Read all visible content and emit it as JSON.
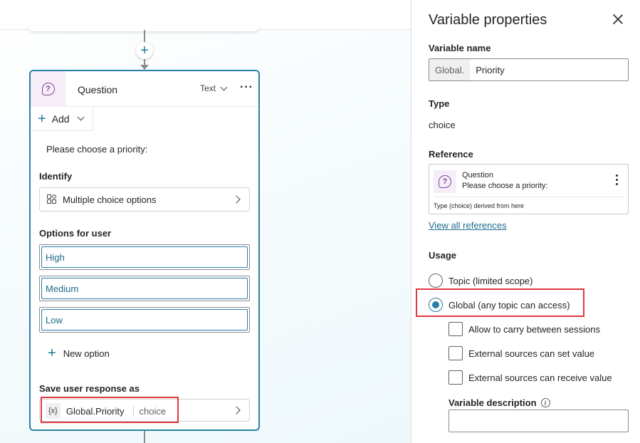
{
  "canvas": {
    "add_node_symbol": "+",
    "node": {
      "title": "Question",
      "type_label": "Text",
      "more_symbol": "···",
      "add_label": "Add",
      "prompt": "Please choose a priority:",
      "identify_label": "Identify",
      "identify_value": "Multiple choice options",
      "options_label": "Options for user",
      "options": [
        "High",
        "Medium",
        "Low"
      ],
      "new_option_label": "New option",
      "save_label": "Save user response as",
      "save_var_icon": "{x}",
      "save_var_name": "Global.Priority",
      "save_var_type": "choice"
    }
  },
  "panel": {
    "title": "Variable properties",
    "var_name_label": "Variable name",
    "var_name_prefix": "Global.",
    "var_name_value": "Priority",
    "type_label": "Type",
    "type_value": "choice",
    "reference_label": "Reference",
    "reference": {
      "title": "Question",
      "subtitle": "Please choose a priority:",
      "derived": "Type (choice) derived from here"
    },
    "view_all_link": "View all references",
    "usage_label": "Usage",
    "usage_options": [
      {
        "label": "Topic (limited scope)",
        "checked": false
      },
      {
        "label": "Global (any topic can access)",
        "checked": true
      }
    ],
    "checkboxes": [
      "Allow to carry between sessions",
      "External sources can set value",
      "External sources can receive value"
    ],
    "description_label": "Variable description",
    "description_value": ""
  },
  "colors": {
    "accent": "#2a7fa8",
    "highlight": "#e0393e",
    "question_icon": "#8a3f9e"
  }
}
